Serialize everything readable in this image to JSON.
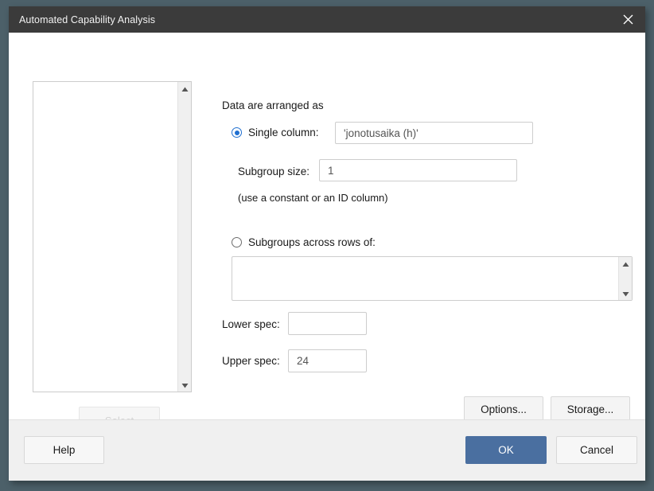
{
  "window": {
    "title": "Automated Capability Analysis",
    "close_icon": "close-icon"
  },
  "left_panel": {
    "variable_list_items": [],
    "select_button_label": "Select",
    "scroll_up_icon": "triangle-up-icon",
    "scroll_down_icon": "triangle-down-icon"
  },
  "form": {
    "arranged_as_label": "Data are arranged as",
    "single_column": {
      "radio_label": "Single column:",
      "selected": true,
      "value": "'jonotusaika (h)'"
    },
    "subgroup_size": {
      "label": "Subgroup size:",
      "value": "1",
      "hint": "(use a constant or an ID column)"
    },
    "subgroups_across_rows": {
      "radio_label": "Subgroups across rows of:",
      "selected": false,
      "value": ""
    },
    "lower_spec": {
      "label": "Lower spec:",
      "value": ""
    },
    "upper_spec": {
      "label": "Upper spec:",
      "value": "24"
    },
    "options_button_label": "Options...",
    "storage_button_label": "Storage..."
  },
  "footer": {
    "help_label": "Help",
    "ok_label": "OK",
    "cancel_label": "Cancel"
  },
  "colors": {
    "titlebar_background": "#3b3b3b",
    "desktop_background": "#4c6069",
    "accent_radio": "#1f6fd0",
    "ok_button_background": "#4a6fa0",
    "footer_background": "#f0f0f0"
  }
}
